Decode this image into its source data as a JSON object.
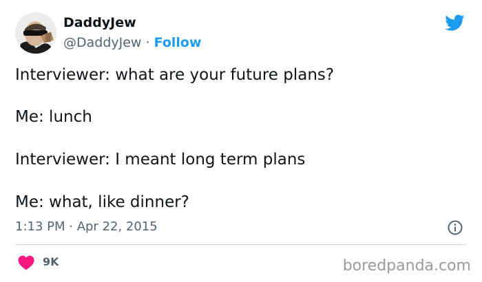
{
  "author": {
    "display_name": "DaddyJew",
    "handle": "@DaddyJew",
    "separator": "·",
    "follow_label": "Follow"
  },
  "tweet": {
    "lines": [
      "Interviewer: what are your future plans?",
      "Me: lunch",
      "Interviewer: I meant long term plans",
      "Me: what, like dinner?"
    ],
    "timestamp": "1:13 PM · Apr 22, 2015"
  },
  "engagement": {
    "like_count": "9K"
  },
  "watermark": "boredpanda.com",
  "icons": {
    "brand": "twitter-bird-icon",
    "info": "info-icon",
    "like": "heart-icon"
  },
  "colors": {
    "accent": "#1d9bf0",
    "heart": "#f91880",
    "text_primary": "#0f1419",
    "text_secondary": "#536471",
    "divider": "#cfd9de",
    "watermark": "#9a9a9a"
  }
}
